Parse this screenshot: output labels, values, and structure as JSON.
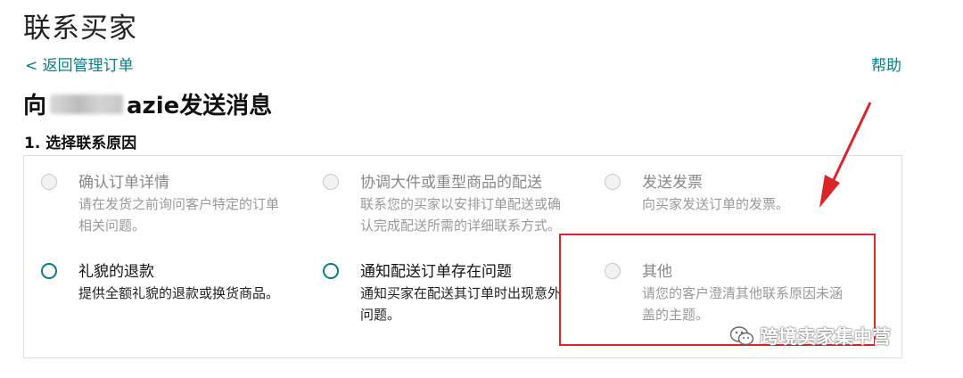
{
  "page": {
    "title": "联系买家"
  },
  "nav": {
    "back_label": "< 返回管理订单",
    "help_label": "帮助"
  },
  "heading": {
    "prefix": "向",
    "suffix": "azie发送消息"
  },
  "step1": {
    "label": "1. 选择联系原因"
  },
  "reasons": [
    {
      "title": "确认订单详情",
      "description": "请在发货之前询问客户特定的订单相关问题。",
      "enabled": false
    },
    {
      "title": "协调大件或重型商品的配送",
      "description": "联系您的买家以安排订单配送或确认完成配送所需的详细联系方式。",
      "enabled": false
    },
    {
      "title": "发送发票",
      "description": "向买家发送订单的发票。",
      "enabled": false
    },
    {
      "title": "礼貌的退款",
      "description": "提供全额礼貌的退款或换货商品。",
      "enabled": true
    },
    {
      "title": "通知配送订单存在问题",
      "description": "通知买家在配送其订单时出现意外问题。",
      "enabled": true
    },
    {
      "title": "其他",
      "description": "请您的客户澄清其他联系原因未涵盖的主题。",
      "enabled": false
    }
  ],
  "annotation": {
    "color": "#d9262b"
  },
  "watermark": {
    "text": "跨境卖家集中营",
    "icon": "wechat-icon"
  },
  "colors": {
    "accent": "#0a7c86",
    "annotation": "#d9262b"
  }
}
